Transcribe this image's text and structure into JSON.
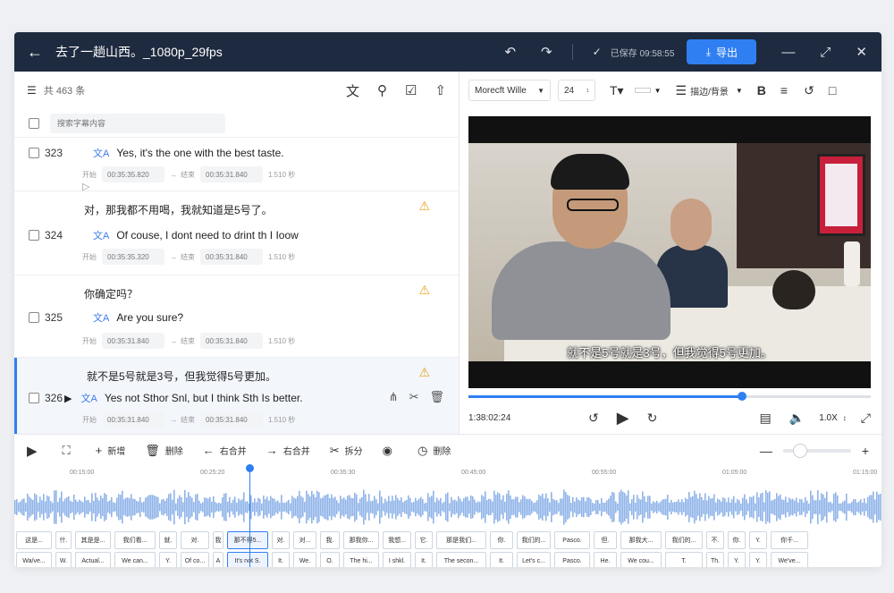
{
  "topbar": {
    "title": "去了一趟山西。_1080p_29fps",
    "save_status": "已保存 09:58:55",
    "export_label": "导出"
  },
  "left": {
    "count": "共 463 条",
    "search_placeholder": "搜索字幕内容",
    "rows": [
      {
        "num": "323",
        "zh": "",
        "en": "Yes, it's the one with the best taste.",
        "start_label": "开始",
        "start": "00:35:35.820",
        "end_label": "结束",
        "end": "00:35:31.840",
        "dur": "1.510 秒",
        "warn": false
      },
      {
        "num": "324",
        "zh": "对，那我都不用喝，我就知道是5号了。",
        "en": "Of couse, I dont need to drint th I Ioow",
        "start_label": "开始",
        "start": "00:35:35.320",
        "end_label": "结束",
        "end": "00:35:31.840",
        "dur": "1.510 秒",
        "warn": true
      },
      {
        "num": "325",
        "zh": "你确定吗？",
        "en": "Are you sure?",
        "start_label": "开始",
        "start": "00:35:31.840",
        "end_label": "结束",
        "end": "00:35:31.840",
        "dur": "1.510 秒",
        "warn": true
      },
      {
        "num": "326",
        "zh": "就不是5号就是3号，但我觉得5号更加。",
        "en": "Yes not Sthor Snl, but I think Sth Is better.",
        "start_label": "开始",
        "start": "00:35:31.840",
        "end_label": "结束",
        "end": "00:35:31.840",
        "dur": "1.510 秒",
        "warn": true
      }
    ]
  },
  "format": {
    "font": "Morecft Wille",
    "size": "24",
    "stroke_label": "描边/背景"
  },
  "video": {
    "subtitle": "就不是5号就是3号，但我觉得5号更加。",
    "time": "1:38:02:24",
    "speed": "1.0X",
    "progress": 0.68
  },
  "toolbar2": {
    "add": "新增",
    "delete": "删除",
    "merge_left": "右合并",
    "merge_right": "右合并",
    "split": "拆分",
    "delete2": "删除",
    "zoom": 0.25
  },
  "timeline": {
    "ticks": [
      "00:15:00",
      "00:25:20",
      "00:35:30",
      "00:45:00",
      "00:55:00",
      "01:05:00",
      "01:15:00",
      "01:25:00"
    ],
    "clips_zh": [
      "这是...",
      "什.",
      "其是是...",
      "我们看...",
      "就.",
      "对.",
      "我",
      "那不得5...",
      "对.",
      "对...",
      "我.",
      "那我你...",
      "我想...",
      "它.",
      "那是我们...",
      "你.",
      "我们的...",
      "Pasco.",
      "但.",
      "那我大...",
      "我们的...",
      "不.",
      "你.",
      "Y.",
      "你千..."
    ],
    "clips_en": [
      "Wa/ve...",
      "W.",
      "Actual...",
      "We can...",
      "Y.",
      "Of co...",
      "A",
      "It's not S.",
      "It.",
      "We.",
      "O.",
      "The hi...",
      "I shkl.",
      "It.",
      "The secon...",
      "It.",
      "Let's c...",
      "Pasco.",
      "He.",
      "We cou...",
      "T.",
      "Th.",
      "Y.",
      "Y.",
      "We've..."
    ]
  }
}
